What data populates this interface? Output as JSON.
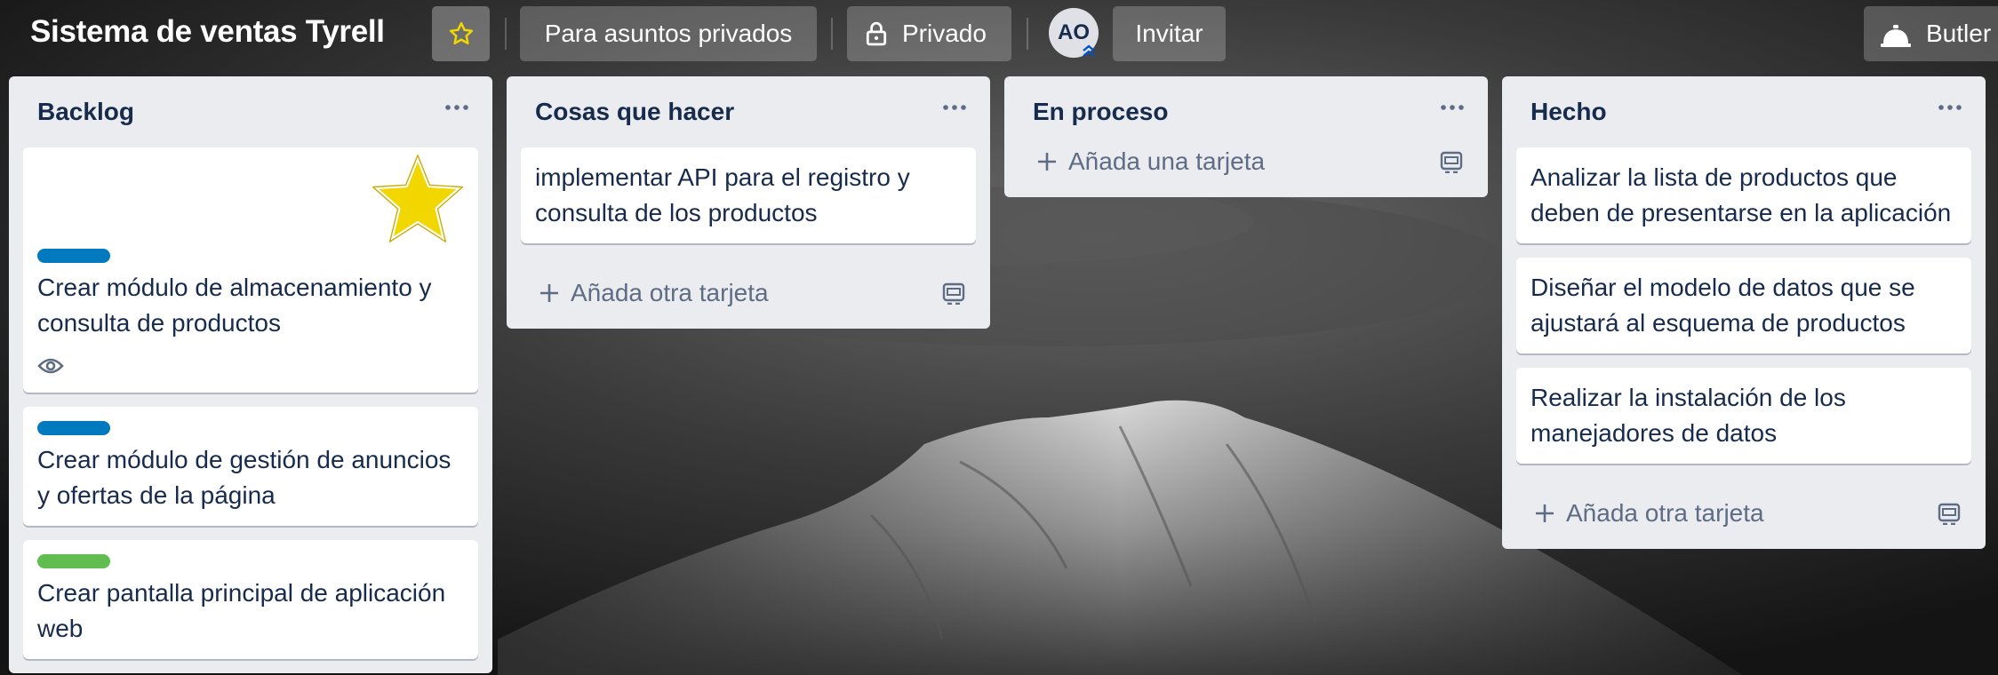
{
  "header": {
    "board_title": "Sistema de ventas Tyrell",
    "team_button": "Para asuntos privados",
    "privacy_button": "Privado",
    "avatar_initials": "AO",
    "invite_button": "Invitar",
    "butler_button": "Butler"
  },
  "lists": [
    {
      "title": "Backlog",
      "cards": [
        {
          "text": "Crear módulo de almacenamiento y consulta de productos",
          "label_color": "#0079bf",
          "sticker": "star-sticker",
          "badge": "eye-icon"
        },
        {
          "text": "Crear módulo de gestión de anuncios y ofertas de la página",
          "label_color": "#0079bf"
        },
        {
          "text": "Crear pantalla principal de aplicación web",
          "label_color": "#61bd4f"
        }
      ]
    },
    {
      "title": "Cosas que hacer",
      "cards": [
        {
          "text": "implementar API para el registro y consulta de los productos"
        }
      ],
      "add_label": "Añada otra tarjeta"
    },
    {
      "title": "En proceso",
      "cards": [],
      "add_label": "Añada una tarjeta"
    },
    {
      "title": "Hecho",
      "cards": [
        {
          "text": "Analizar la lista de productos que deben de presentarse en la aplicación"
        },
        {
          "text": "Diseñar el modelo de datos que se ajustará al esquema de productos"
        },
        {
          "text": "Realizar la instalación de los manejadores de datos"
        }
      ],
      "add_label": "Añada otra tarjeta"
    }
  ],
  "colors": {
    "list_bg": "#ebecf0",
    "label_blue": "#0079bf",
    "label_green": "#61bd4f",
    "star_yellow": "#f2d600"
  }
}
